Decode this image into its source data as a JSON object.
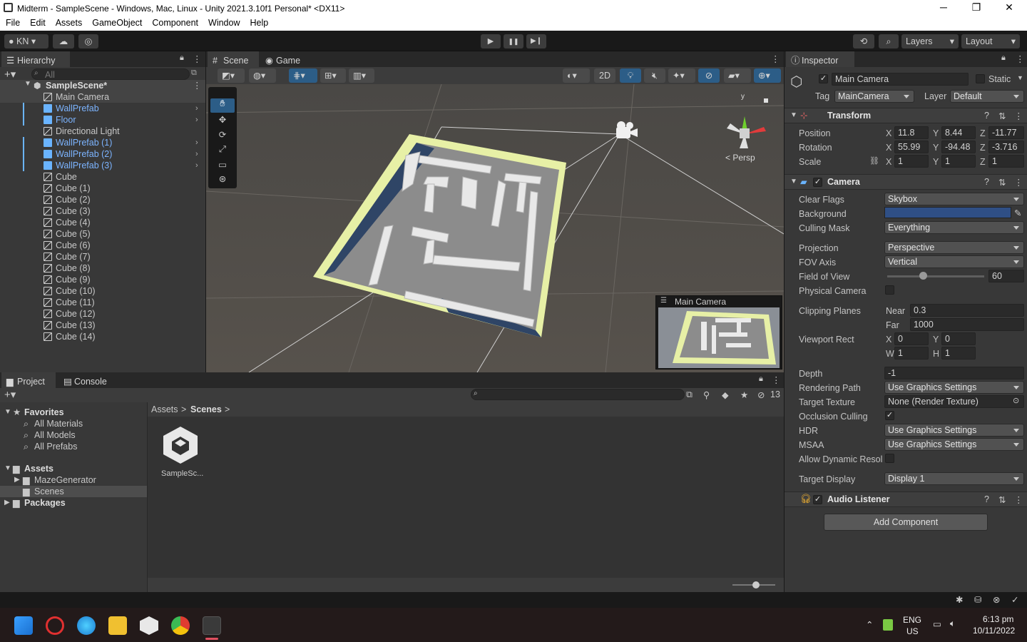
{
  "window": {
    "title": "Midterm - SampleScene - Windows, Mac, Linux - Unity 2021.3.10f1 Personal* <DX11>",
    "minimize": "─",
    "maximize": "❐",
    "close": "✕"
  },
  "menu": [
    "File",
    "Edit",
    "Assets",
    "GameObject",
    "Component",
    "Window",
    "Help"
  ],
  "toolbar": {
    "account": "KN",
    "play": "▶",
    "pause": "❚❚",
    "step": "▶❙",
    "layers": "Layers",
    "layout": "Layout"
  },
  "hierarchy": {
    "tab": "Hierarchy",
    "search_placeholder": "All",
    "scene": "SampleScene*",
    "items": [
      {
        "label": "Main Camera",
        "prefab": false,
        "arrow": false
      },
      {
        "label": "WallPrefab",
        "prefab": true,
        "arrow": true
      },
      {
        "label": "Floor",
        "prefab": true,
        "arrow": true
      },
      {
        "label": "Directional Light",
        "prefab": false,
        "arrow": false
      },
      {
        "label": "WallPrefab (1)",
        "prefab": true,
        "arrow": true
      },
      {
        "label": "WallPrefab (2)",
        "prefab": true,
        "arrow": true
      },
      {
        "label": "WallPrefab (3)",
        "prefab": true,
        "arrow": true
      },
      {
        "label": "Cube",
        "prefab": false,
        "arrow": false
      },
      {
        "label": "Cube (1)",
        "prefab": false,
        "arrow": false
      },
      {
        "label": "Cube (2)",
        "prefab": false,
        "arrow": false
      },
      {
        "label": "Cube (3)",
        "prefab": false,
        "arrow": false
      },
      {
        "label": "Cube (4)",
        "prefab": false,
        "arrow": false
      },
      {
        "label": "Cube (5)",
        "prefab": false,
        "arrow": false
      },
      {
        "label": "Cube (6)",
        "prefab": false,
        "arrow": false
      },
      {
        "label": "Cube (7)",
        "prefab": false,
        "arrow": false
      },
      {
        "label": "Cube (8)",
        "prefab": false,
        "arrow": false
      },
      {
        "label": "Cube (9)",
        "prefab": false,
        "arrow": false
      },
      {
        "label": "Cube (10)",
        "prefab": false,
        "arrow": false
      },
      {
        "label": "Cube (11)",
        "prefab": false,
        "arrow": false
      },
      {
        "label": "Cube (12)",
        "prefab": false,
        "arrow": false
      },
      {
        "label": "Cube (13)",
        "prefab": false,
        "arrow": false
      },
      {
        "label": "Cube (14)",
        "prefab": false,
        "arrow": false
      }
    ]
  },
  "scene": {
    "tab_scene": "Scene",
    "tab_game": "Game",
    "btn_2d": "2D",
    "persp": "< Persp",
    "axis_y": "y",
    "cam_preview_title": "Main Camera"
  },
  "project": {
    "tab_project": "Project",
    "tab_console": "Console",
    "hidden_count": "13",
    "favorites": "Favorites",
    "fav_items": [
      "All Materials",
      "All Models",
      "All Prefabs"
    ],
    "assets": "Assets",
    "asset_items": [
      "MazeGenerator",
      "Scenes"
    ],
    "packages": "Packages",
    "breadcrumb_root": "Assets",
    "breadcrumb_sep": ">",
    "breadcrumb_leaf": "Scenes",
    "file_label": "SampleSc..."
  },
  "inspector": {
    "tab": "Inspector",
    "object_name": "Main Camera",
    "static_label": "Static",
    "tag_label": "Tag",
    "tag_value": "MainCamera",
    "layer_label": "Layer",
    "layer_value": "Default",
    "transform": {
      "title": "Transform",
      "position_label": "Position",
      "rotation_label": "Rotation",
      "scale_label": "Scale",
      "pos": [
        "11.8",
        "8.44",
        "-11.77"
      ],
      "rot": [
        "55.99",
        "-94.48",
        "-3.716"
      ],
      "scale": [
        "1",
        "1",
        "1"
      ]
    },
    "camera": {
      "title": "Camera",
      "clear_flags_label": "Clear Flags",
      "clear_flags": "Skybox",
      "background_label": "Background",
      "background_color": "#2f4f85",
      "culling_mask_label": "Culling Mask",
      "culling_mask": "Everything",
      "projection_label": "Projection",
      "projection": "Perspective",
      "fov_axis_label": "FOV Axis",
      "fov_axis": "Vertical",
      "fov_label": "Field of View",
      "fov": "60",
      "fov_fraction": 0.33,
      "physical_label": "Physical Camera",
      "clipping_label": "Clipping Planes",
      "near_label": "Near",
      "near": "0.3",
      "far_label": "Far",
      "far": "1000",
      "viewport_label": "Viewport Rect",
      "vx": "0",
      "vy": "0",
      "vw": "1",
      "vh": "1",
      "depth_label": "Depth",
      "depth": "-1",
      "rendering_path_label": "Rendering Path",
      "rendering_path": "Use Graphics Settings",
      "target_texture_label": "Target Texture",
      "target_texture": "None (Render Texture)",
      "occlusion_label": "Occlusion Culling",
      "hdr_label": "HDR",
      "hdr": "Use Graphics Settings",
      "msaa_label": "MSAA",
      "msaa": "Use Graphics Settings",
      "dynres_label": "Allow Dynamic Resol",
      "target_display_label": "Target Display",
      "target_display": "Display 1"
    },
    "audio": {
      "title": "Audio Listener"
    },
    "add_component": "Add Component"
  },
  "taskbar": {
    "lang1": "ENG",
    "lang2": "US",
    "time": "6:13 pm",
    "date": "10/11/2022"
  },
  "colors": {
    "selection": "#2c5d87",
    "prefab_text": "#7cb4ff",
    "maze_border": "#e8f0a8",
    "floor": "#8a8a8a"
  }
}
